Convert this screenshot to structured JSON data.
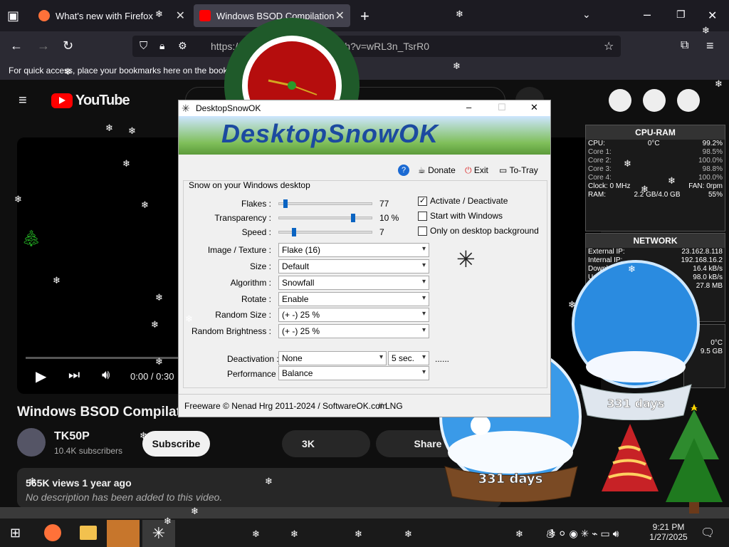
{
  "browser": {
    "tabs": [
      {
        "title": "What's new with Firefox",
        "icon_color": "#ff7139"
      },
      {
        "title": "Windows BSOD Compilation P",
        "icon_color": "#ff0000"
      }
    ],
    "url": "https://www.youtube.com/watch?v=wRL3n_TsrR0",
    "bookmark_hint": "For quick access, place your bookmarks here on the bookmarks toolbar."
  },
  "youtube": {
    "logo": "YouTube",
    "player": {
      "time": "0:00 / 0:30"
    },
    "video_title": "Windows BSOD Compilation",
    "channel": {
      "name": "TK50P",
      "subscribers": "10.4K subscribers"
    },
    "subscribe_label": "Subscribe",
    "likes": "3K",
    "share_label": "Share",
    "stats": "565K views  1 year ago",
    "description": "No description has been added to this video."
  },
  "dialog": {
    "title": "DesktopSnowOK",
    "banner": "DesktopSnowOK",
    "toolbar": {
      "donate": "Donate",
      "exit": "Exit",
      "to_tray": "To-Tray"
    },
    "section": "Snow on your Windows desktop",
    "sliders": [
      {
        "label": "Flakes :",
        "value": "77",
        "level": 0.05
      },
      {
        "label": "Transparency :",
        "value": "10 %",
        "level": 0.8
      },
      {
        "label": "Speed :",
        "value": "7",
        "level": 0.14
      }
    ],
    "checkboxes": [
      {
        "label": "Activate / Deactivate",
        "checked": true
      },
      {
        "label": "Start with Windows",
        "checked": false
      },
      {
        "label": "Only on desktop background",
        "checked": false
      }
    ],
    "combos": [
      {
        "label": "Image / Texture :",
        "value": "Flake (16)"
      },
      {
        "label": "Size :",
        "value": "Default"
      },
      {
        "label": "Algorithm :",
        "value": "Snowfall"
      },
      {
        "label": "Rotate :",
        "value": "Enable"
      },
      {
        "label": "Random Size :",
        "value": "(+ -) 25 %"
      },
      {
        "label": "Random Brightness :",
        "value": "(+ -) 25 %"
      }
    ],
    "deactivation": {
      "label": "Deactivation :",
      "value": "None",
      "seconds": "5 sec.",
      "dots": "......"
    },
    "performance": {
      "label": "Performance :",
      "value": "Balance"
    },
    "footer": {
      "copyright": "Freeware © Nenad Hrg 2011-2024 / SoftwareOK.com",
      "lng": "# LNG"
    }
  },
  "cpu_ram": {
    "header": "CPU-RAM",
    "rows": [
      {
        "label": "CPU:",
        "mid": "0°C",
        "value": "99.2%"
      },
      {
        "label": "Core 1:",
        "mid": "",
        "value": "98.5%"
      },
      {
        "label": "Core 2:",
        "mid": "",
        "value": "100.0%"
      },
      {
        "label": "Core 3:",
        "mid": "",
        "value": "98.8%"
      },
      {
        "label": "Core 4:",
        "mid": "",
        "value": "100.0%"
      },
      {
        "label": "Clock: 0 MHz",
        "mid": "",
        "value": "FAN: 0rpm"
      },
      {
        "label": "RAM:",
        "mid": "2.2 GB/4.0 GB",
        "value": "55%"
      }
    ]
  },
  "network": {
    "header": "NETWORK",
    "rows": [
      {
        "label": "External IP:",
        "value": "23.162.8.118"
      },
      {
        "label": "Internal IP:",
        "value": "192.168.16.2"
      },
      {
        "label": "Download:",
        "value": "16.4 kB/s"
      },
      {
        "label": "Upload:",
        "value": "98.0 kB/s"
      },
      {
        "label": "",
        "value": "27.8 MB"
      }
    ]
  },
  "drive_panel": {
    "temp": "0°C",
    "size": "9.5 GB"
  },
  "snow_globes": {
    "large": "331 days",
    "small": "331 days"
  },
  "taskbar": {
    "time": "9:21 PM",
    "date": "1/27/2025"
  },
  "colors": {
    "accent": "#0a64c2",
    "yt_red": "#ff0000",
    "chrome_dark": "#1c1b22"
  }
}
